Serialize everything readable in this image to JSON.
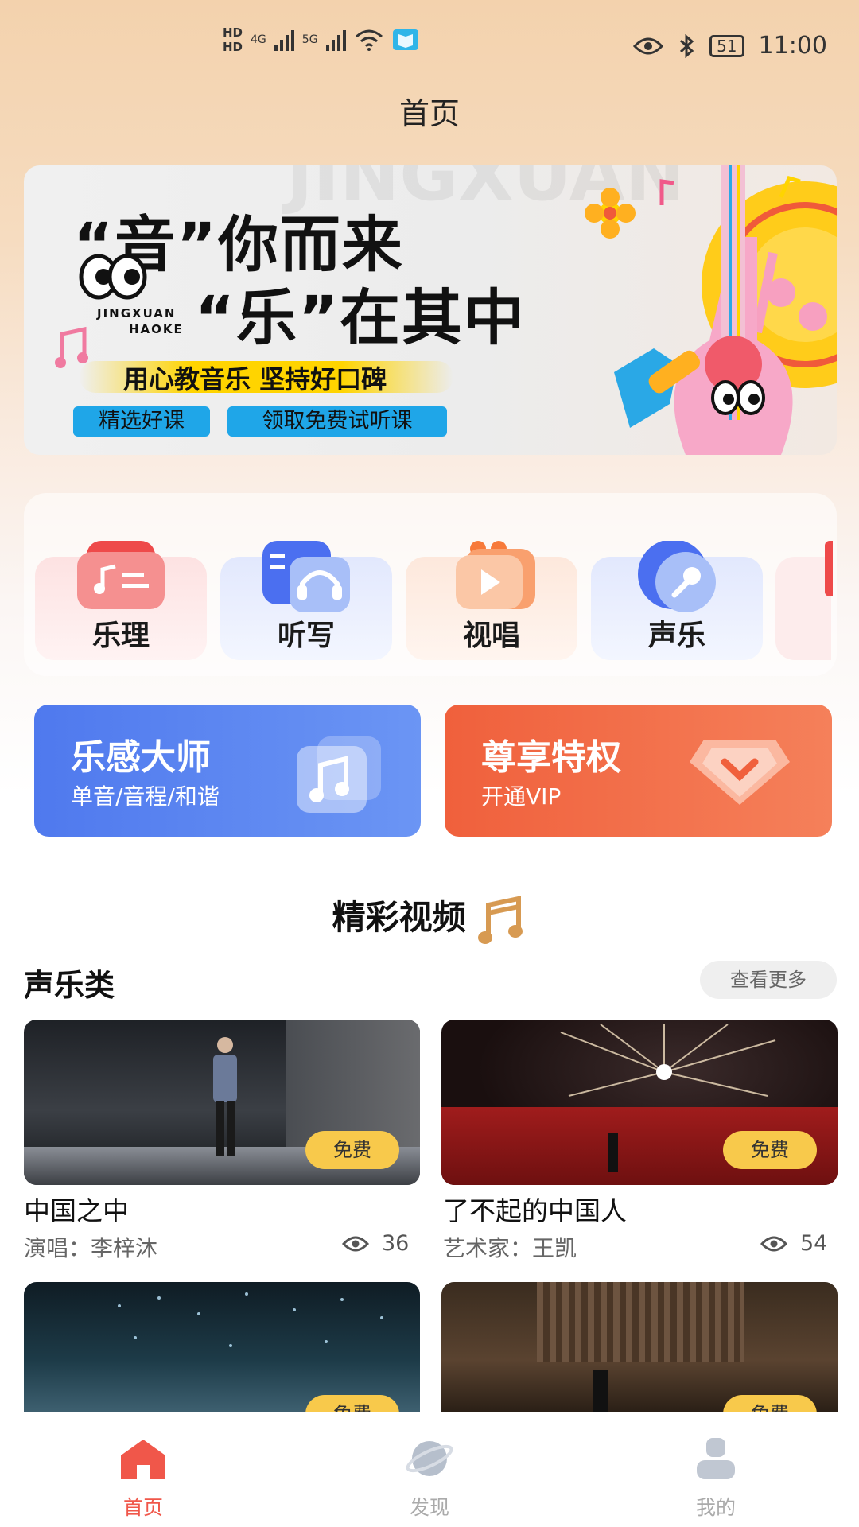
{
  "status_bar": {
    "time": "11:00",
    "battery": "51",
    "network_1": "4G",
    "network_2": "5G",
    "hd": "HD"
  },
  "header": {
    "title": "首页"
  },
  "banner": {
    "line1": "“音”你而来",
    "line2": "“乐”在其中",
    "brand_1": "JINGXUAN",
    "brand_2": "HAOKE",
    "slogan": "用心教音乐 坚持好口碑",
    "tag1": "精选好课",
    "tag2": "领取免费试听课"
  },
  "categories": [
    {
      "label": "乐理",
      "icon": "music-theory-icon"
    },
    {
      "label": "听写",
      "icon": "headphones-icon"
    },
    {
      "label": "视唱",
      "icon": "play-icon"
    },
    {
      "label": "声乐",
      "icon": "microphone-icon"
    }
  ],
  "promos": [
    {
      "title": "乐感大师",
      "subtitle": "单音/音程/和谐",
      "color": "#5b84f2"
    },
    {
      "title": "尊享特权",
      "subtitle": "开通VIP",
      "color": "#f16a45"
    }
  ],
  "videos_section": {
    "title": "精彩视频",
    "category": "声乐类",
    "more": "查看更多",
    "free_label": "免费",
    "items": [
      {
        "title": "中国之中",
        "artist": "演唱：李梓沐",
        "views": "36"
      },
      {
        "title": "了不起的中国人",
        "artist": "艺术家：王凯",
        "views": "54"
      }
    ]
  },
  "bottom_nav": [
    {
      "label": "首页",
      "active": true
    },
    {
      "label": "发现",
      "active": false
    },
    {
      "label": "我的",
      "active": false
    }
  ],
  "colors": {
    "accent": "#f0574a",
    "vip": "#f16a45",
    "blue": "#5b84f2",
    "badge": "#f8c94b"
  }
}
